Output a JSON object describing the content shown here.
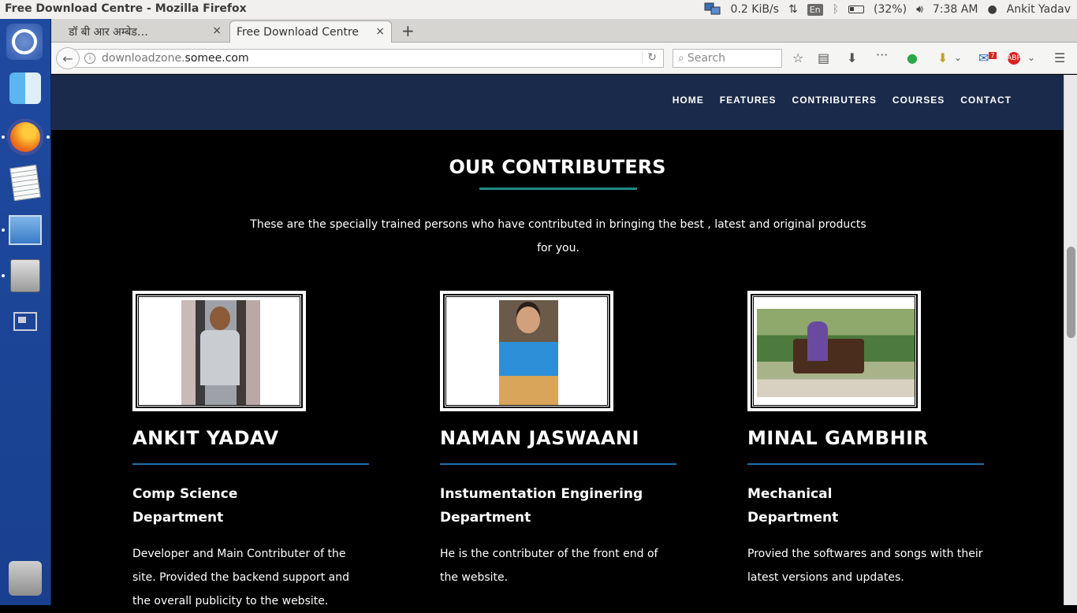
{
  "os_panel": {
    "window_title": "Free Download Centre - Mozilla Firefox",
    "network_speed": "0.2 KiB/s",
    "language": "En",
    "battery": "(32%)",
    "time": "7:38 AM",
    "user": "Ankit Yadav",
    "icons": [
      "network-icon",
      "transfer-icon",
      "keyboard-language-icon",
      "bluetooth-icon",
      "battery-icon",
      "volume-icon",
      "apple-menu-icon"
    ]
  },
  "launcher": {
    "items": [
      "dash-home-icon",
      "finder-icon",
      "firefox-icon",
      "text-editor-icon",
      "xcode-icon",
      "disk-drive-icon",
      "workspace-switcher-icon",
      "trash-icon"
    ]
  },
  "browser": {
    "tabs": [
      {
        "label": "डॉ बी आर अम्बेड…",
        "active": false
      },
      {
        "label": "Free Download Centre",
        "active": true
      }
    ],
    "new_tab": "+",
    "close_glyph": "×",
    "url_prefix": "downloadzone.",
    "url_domain": "somee.com",
    "search_placeholder": "Search",
    "toolbar_icons": [
      "bookmark-star-icon",
      "reading-list-icon",
      "download-icon",
      "overflow-icon",
      "extension-icon",
      "pocket-icon",
      "chevron-down-icon",
      "outlook-icon",
      "adblock-icon",
      "chevron-down-icon",
      "hamburger-menu-icon"
    ],
    "outlook_badge": "7",
    "adblock_label": "ABP"
  },
  "site": {
    "nav": [
      "HOME",
      "FEATURES",
      "CONTRIBUTERS",
      "COURSES",
      "CONTACT"
    ],
    "section_title": "OUR CONTRIBUTERS",
    "section_desc": "These are the specially trained persons who have contributed in bringing the best , latest and original products for you.",
    "accent_color": "#1e8c84",
    "header_color": "#1a2a4a",
    "members": [
      {
        "name": "ANKIT YADAV",
        "dept_line1": "Comp Science",
        "dept_line2": "Department",
        "desc": "Developer and Main Contributer of the site. Provided the backend support and the overall publicity to the website."
      },
      {
        "name": "NAMAN JASWAANI",
        "dept_line1": "Instumentation Enginering",
        "dept_line2": "Department",
        "desc": "He is the contributer of the front end of the website."
      },
      {
        "name": "MINAL GAMBHIR",
        "dept_line1": "Mechanical",
        "dept_line2": "Department",
        "desc": "Provied the softwares and songs with their latest versions and updates."
      }
    ]
  }
}
